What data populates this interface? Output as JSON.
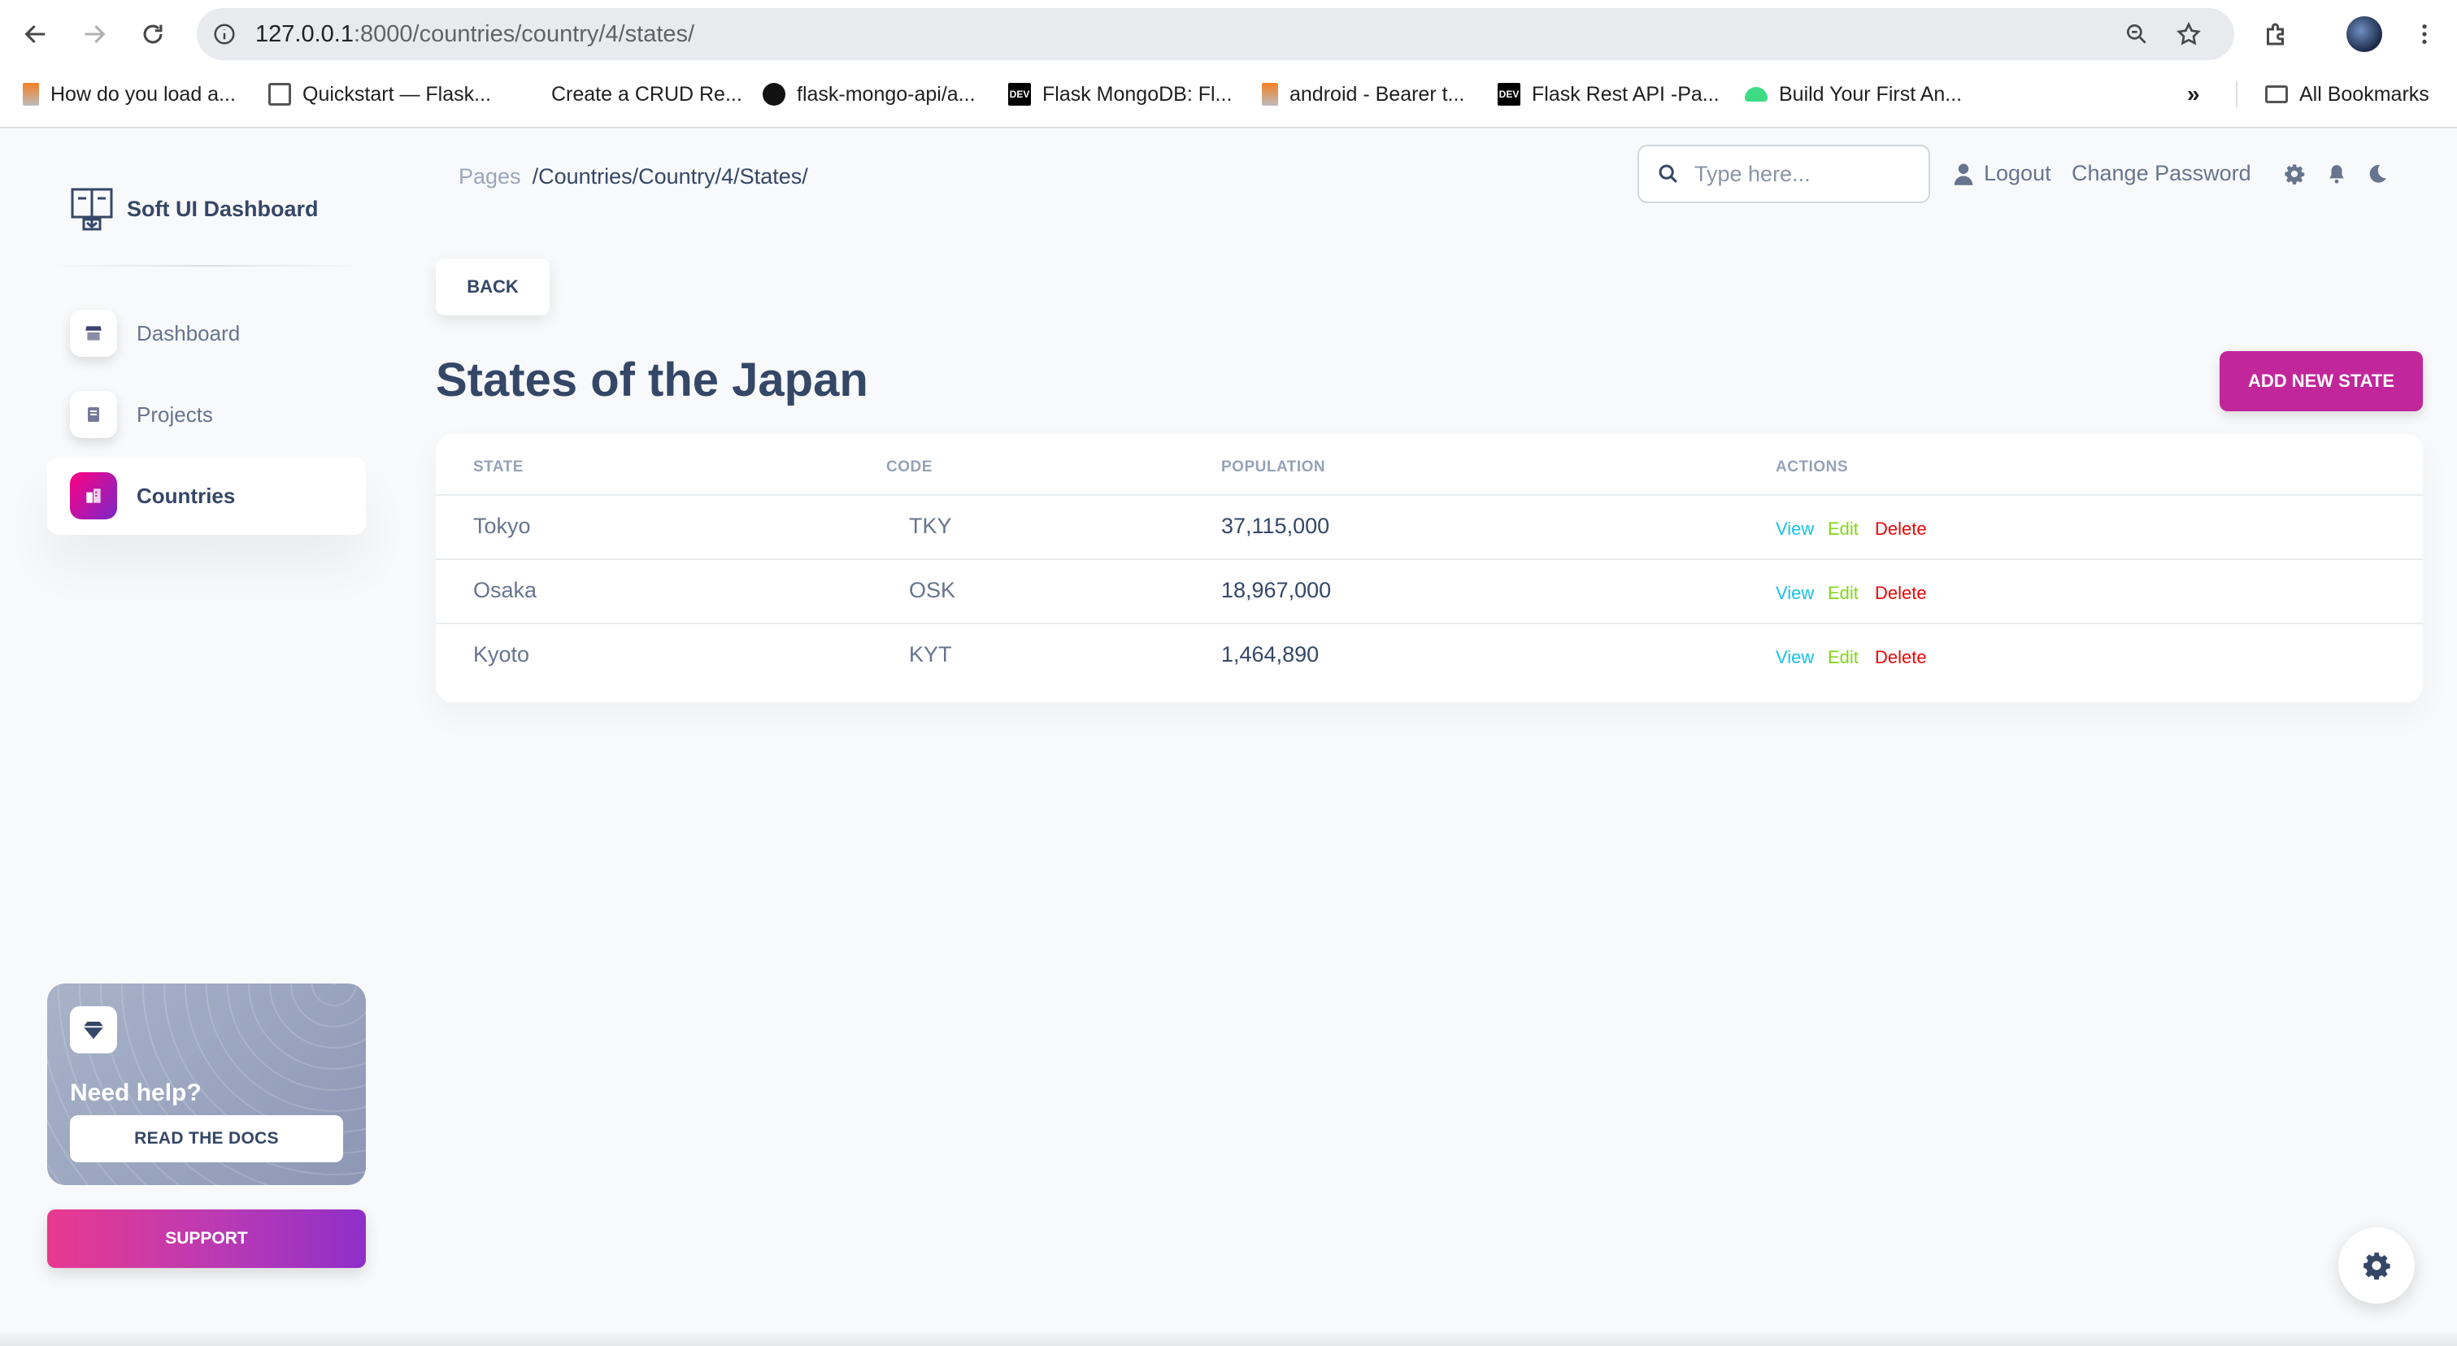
{
  "browser": {
    "url_host": "127.0.0.1",
    "url_rest": ":8000/countries/country/4/states/",
    "bookmarks": [
      {
        "label": "How do you load a...",
        "icon": "stackoverflow-icon"
      },
      {
        "label": "Quickstart — Flask...",
        "icon": "document-icon"
      },
      {
        "label": "Create a CRUD Re...",
        "icon": "blank-icon"
      },
      {
        "label": "flask-mongo-api/a...",
        "icon": "github-icon"
      },
      {
        "label": "Flask MongoDB: Fl...",
        "icon": "dev-icon"
      },
      {
        "label": "android - Bearer t...",
        "icon": "stackoverflow-icon"
      },
      {
        "label": "Flask Rest API -Pa...",
        "icon": "dev-icon"
      },
      {
        "label": "Build Your First An...",
        "icon": "android-icon"
      }
    ],
    "all_bookmarks": "All Bookmarks",
    "dev_glyph": "DEV"
  },
  "sidebar": {
    "brand": "Soft UI Dashboard",
    "items": [
      {
        "label": "Dashboard",
        "icon": "shop-icon"
      },
      {
        "label": "Projects",
        "icon": "document-icon"
      },
      {
        "label": "Countries",
        "icon": "office-icon",
        "active": true
      }
    ],
    "help": {
      "title": "Need help?",
      "button": "READ THE DOCS"
    },
    "support": "SUPPORT"
  },
  "navbar": {
    "breadcrumb_root": "Pages",
    "breadcrumb_path": "/Countries/Country/4/States/",
    "search_placeholder": "Type here...",
    "logout": "Logout",
    "change_password": "Change Password"
  },
  "main": {
    "back": "BACK",
    "title": "States of the Japan",
    "add_button": "ADD NEW STATE",
    "table": {
      "headers": [
        "STATE",
        "CODE",
        "POPULATION",
        "ACTIONS"
      ],
      "rows": [
        {
          "state": "Tokyo",
          "code": "TKY",
          "population": "37,115,000"
        },
        {
          "state": "Osaka",
          "code": "OSK",
          "population": "18,967,000"
        },
        {
          "state": "Kyoto",
          "code": "KYT",
          "population": "1,464,890"
        }
      ],
      "actions": {
        "view": "View",
        "edit": "Edit",
        "delete": "Delete"
      }
    }
  },
  "colors": {
    "accent": "#cb0c9f",
    "primary_text": "#344767",
    "secondary_text": "#67748e",
    "view": "#17c1e8",
    "edit": "#82d616",
    "delete": "#ea0606"
  }
}
